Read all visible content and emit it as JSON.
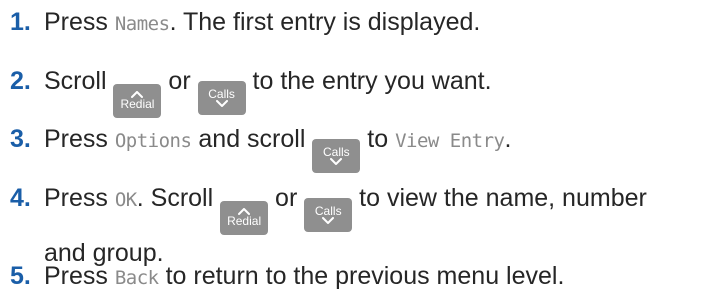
{
  "steps": [
    {
      "number": "1.",
      "segments": [
        {
          "t": "Press "
        },
        {
          "lcd": "Names"
        },
        {
          "t": ". The first entry is displayed."
        }
      ]
    },
    {
      "number": "2.",
      "segments": [
        {
          "t": "Scroll "
        },
        {
          "key": "Redial",
          "arrow": "up"
        },
        {
          "t": " or "
        },
        {
          "key": "Calls",
          "arrow": "down"
        },
        {
          "t": " to the entry you want."
        }
      ]
    },
    {
      "number": "3.",
      "segments": [
        {
          "t": "Press "
        },
        {
          "lcd": "Options"
        },
        {
          "t": " and scroll "
        },
        {
          "key": "Calls",
          "arrow": "down"
        },
        {
          "t": " to "
        },
        {
          "lcd": "View Entry"
        },
        {
          "t": "."
        }
      ]
    },
    {
      "number": "4.",
      "segments": [
        {
          "t": "Press "
        },
        {
          "lcd": "OK"
        },
        {
          "t": ". Scroll "
        },
        {
          "key": "Redial",
          "arrow": "up"
        },
        {
          "t": " or "
        },
        {
          "key": "Calls",
          "arrow": "down"
        },
        {
          "t": " to view the name, number and group."
        }
      ]
    },
    {
      "number": "5.",
      "segments": [
        {
          "t": "Press "
        },
        {
          "lcd": "Back"
        },
        {
          "t": " to return to the previous menu level."
        }
      ]
    }
  ],
  "colors": {
    "step_number": "#1a5ea8",
    "body_text": "#262626",
    "display_text": "#8a8a8a",
    "key_background": "#8f8f8f",
    "key_text": "#ffffff"
  }
}
